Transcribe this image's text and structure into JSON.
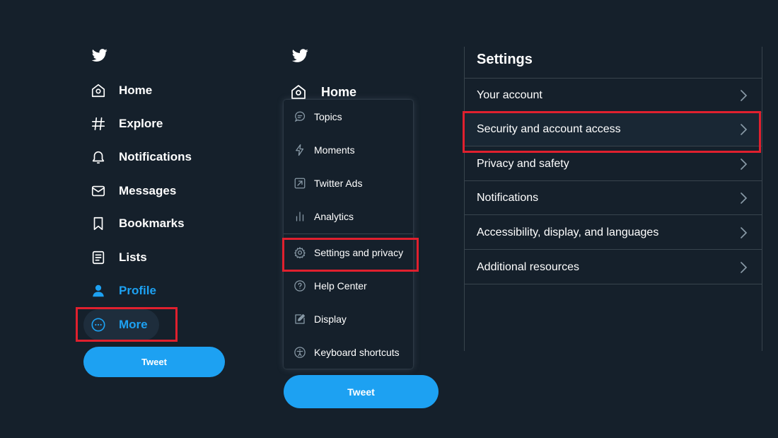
{
  "colors": {
    "background": "#15202b",
    "accent": "#1da1f2",
    "highlight": "#e0202e",
    "divider": "#38444d",
    "text": "#ffffff"
  },
  "left_nav": {
    "logo_icon": "twitter-bird-icon",
    "items": [
      {
        "label": "Home",
        "icon": "home-icon"
      },
      {
        "label": "Explore",
        "icon": "hashtag-icon"
      },
      {
        "label": "Notifications",
        "icon": "bell-icon"
      },
      {
        "label": "Messages",
        "icon": "envelope-icon"
      },
      {
        "label": "Bookmarks",
        "icon": "bookmark-icon"
      },
      {
        "label": "Lists",
        "icon": "list-icon"
      },
      {
        "label": "Profile",
        "icon": "person-icon"
      },
      {
        "label": "More",
        "icon": "more-circle-icon"
      }
    ],
    "tweet_label": "Tweet"
  },
  "middle": {
    "logo_icon": "twitter-bird-icon",
    "home_label": "Home",
    "dropdown": [
      {
        "label": "Topics",
        "icon": "topics-icon"
      },
      {
        "label": "Moments",
        "icon": "lightning-icon"
      },
      {
        "label": "Twitter Ads",
        "icon": "ads-icon"
      },
      {
        "label": "Analytics",
        "icon": "analytics-icon"
      },
      {
        "label": "Settings and privacy",
        "icon": "gear-icon"
      },
      {
        "label": "Help Center",
        "icon": "help-icon"
      },
      {
        "label": "Display",
        "icon": "display-icon"
      },
      {
        "label": "Keyboard shortcuts",
        "icon": "accessibility-icon"
      }
    ],
    "tweet_label": "Tweet"
  },
  "settings": {
    "title": "Settings",
    "rows": [
      {
        "label": "Your account"
      },
      {
        "label": "Security and account access"
      },
      {
        "label": "Privacy and safety"
      },
      {
        "label": "Notifications"
      },
      {
        "label": "Accessibility, display, and languages"
      },
      {
        "label": "Additional resources"
      }
    ]
  }
}
